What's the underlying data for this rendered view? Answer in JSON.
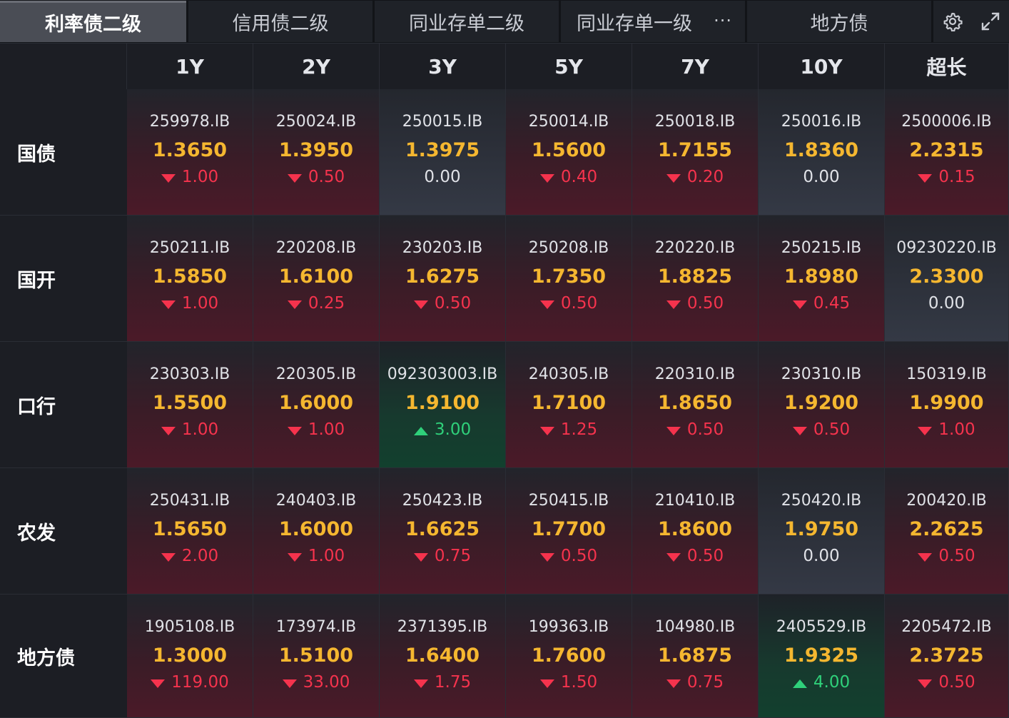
{
  "tabs": [
    {
      "label": "利率债二级",
      "active": true
    },
    {
      "label": "信用债二级",
      "active": false
    },
    {
      "label": "同业存单二级",
      "active": false
    },
    {
      "label": "同业存单一级",
      "active": false,
      "more": "···"
    },
    {
      "label": "地方债",
      "active": false
    }
  ],
  "toolbar": {
    "settings_icon": "gear-icon",
    "expand_icon": "expand-icon"
  },
  "columns": [
    "1Y",
    "2Y",
    "3Y",
    "5Y",
    "7Y",
    "10Y",
    "超长"
  ],
  "colors": {
    "up": "#2fd07a",
    "down": "#f5334d",
    "yield": "#f5b730"
  },
  "rows": [
    {
      "label": "国债",
      "cells": [
        {
          "code": "259978.IB",
          "yield": "1.3650",
          "change": "1.00",
          "dir": "down"
        },
        {
          "code": "250024.IB",
          "yield": "1.3950",
          "change": "0.50",
          "dir": "down"
        },
        {
          "code": "250015.IB",
          "yield": "1.3975",
          "change": "0.00",
          "dir": "flat"
        },
        {
          "code": "250014.IB",
          "yield": "1.5600",
          "change": "0.40",
          "dir": "down"
        },
        {
          "code": "250018.IB",
          "yield": "1.7155",
          "change": "0.20",
          "dir": "down"
        },
        {
          "code": "250016.IB",
          "yield": "1.8360",
          "change": "0.00",
          "dir": "flat"
        },
        {
          "code": "2500006.IB",
          "yield": "2.2315",
          "change": "0.15",
          "dir": "down"
        }
      ]
    },
    {
      "label": "国开",
      "cells": [
        {
          "code": "250211.IB",
          "yield": "1.5850",
          "change": "1.00",
          "dir": "down"
        },
        {
          "code": "220208.IB",
          "yield": "1.6100",
          "change": "0.25",
          "dir": "down"
        },
        {
          "code": "230203.IB",
          "yield": "1.6275",
          "change": "0.50",
          "dir": "down"
        },
        {
          "code": "250208.IB",
          "yield": "1.7350",
          "change": "0.50",
          "dir": "down"
        },
        {
          "code": "220220.IB",
          "yield": "1.8825",
          "change": "0.50",
          "dir": "down"
        },
        {
          "code": "250215.IB",
          "yield": "1.8980",
          "change": "0.45",
          "dir": "down"
        },
        {
          "code": "09230220.IB",
          "yield": "2.3300",
          "change": "0.00",
          "dir": "flat"
        }
      ]
    },
    {
      "label": "口行",
      "cells": [
        {
          "code": "230303.IB",
          "yield": "1.5500",
          "change": "1.00",
          "dir": "down"
        },
        {
          "code": "220305.IB",
          "yield": "1.6000",
          "change": "1.00",
          "dir": "down"
        },
        {
          "code": "092303003.IB",
          "yield": "1.9100",
          "change": "3.00",
          "dir": "up"
        },
        {
          "code": "240305.IB",
          "yield": "1.7100",
          "change": "1.25",
          "dir": "down"
        },
        {
          "code": "220310.IB",
          "yield": "1.8650",
          "change": "0.50",
          "dir": "down"
        },
        {
          "code": "230310.IB",
          "yield": "1.9200",
          "change": "0.50",
          "dir": "down"
        },
        {
          "code": "150319.IB",
          "yield": "1.9900",
          "change": "1.00",
          "dir": "down"
        }
      ]
    },
    {
      "label": "农发",
      "cells": [
        {
          "code": "250431.IB",
          "yield": "1.5650",
          "change": "2.00",
          "dir": "down"
        },
        {
          "code": "240403.IB",
          "yield": "1.6000",
          "change": "1.00",
          "dir": "down"
        },
        {
          "code": "250423.IB",
          "yield": "1.6625",
          "change": "0.75",
          "dir": "down"
        },
        {
          "code": "250415.IB",
          "yield": "1.7700",
          "change": "0.50",
          "dir": "down"
        },
        {
          "code": "210410.IB",
          "yield": "1.8600",
          "change": "0.50",
          "dir": "down"
        },
        {
          "code": "250420.IB",
          "yield": "1.9750",
          "change": "0.00",
          "dir": "flat"
        },
        {
          "code": "200420.IB",
          "yield": "2.2625",
          "change": "0.50",
          "dir": "down"
        }
      ]
    },
    {
      "label": "地方债",
      "cells": [
        {
          "code": "1905108.IB",
          "yield": "1.3000",
          "change": "119.00",
          "dir": "down"
        },
        {
          "code": "173974.IB",
          "yield": "1.5100",
          "change": "33.00",
          "dir": "down"
        },
        {
          "code": "2371395.IB",
          "yield": "1.6400",
          "change": "1.75",
          "dir": "down"
        },
        {
          "code": "199363.IB",
          "yield": "1.7600",
          "change": "1.50",
          "dir": "down"
        },
        {
          "code": "104980.IB",
          "yield": "1.6875",
          "change": "0.75",
          "dir": "down"
        },
        {
          "code": "2405529.IB",
          "yield": "1.9325",
          "change": "4.00",
          "dir": "up"
        },
        {
          "code": "2205472.IB",
          "yield": "2.3725",
          "change": "0.50",
          "dir": "down"
        }
      ]
    }
  ]
}
